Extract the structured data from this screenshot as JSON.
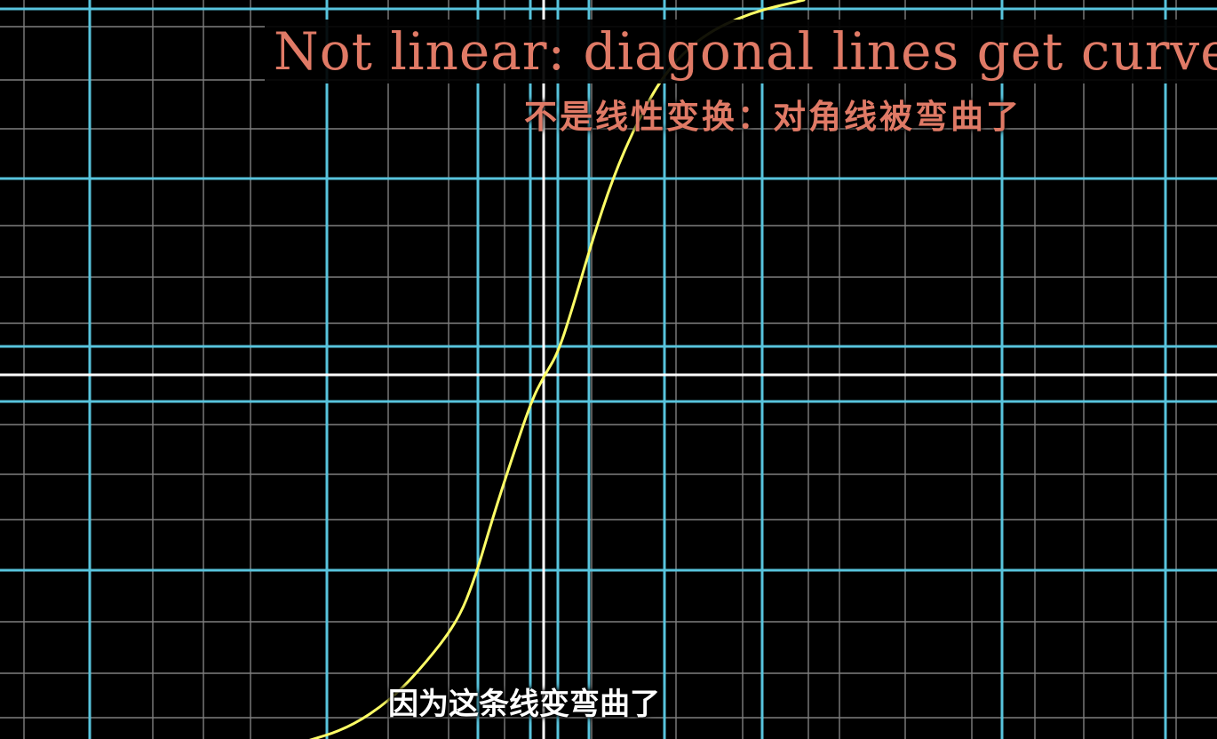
{
  "scene": {
    "background": "#000000",
    "colors": {
      "fine_grid": "#7f7f7f",
      "blue_grid": "#58c4dd",
      "axis": "#ffffff",
      "curve": "#ffff66",
      "title": "#e07a66",
      "subtitle": "#ffffff"
    }
  },
  "title_en": "Not linear: diagonal lines get curved",
  "title_zh": "不是线性变换：对角线被弯曲了",
  "subtitle": "因为这条线变弯曲了"
}
